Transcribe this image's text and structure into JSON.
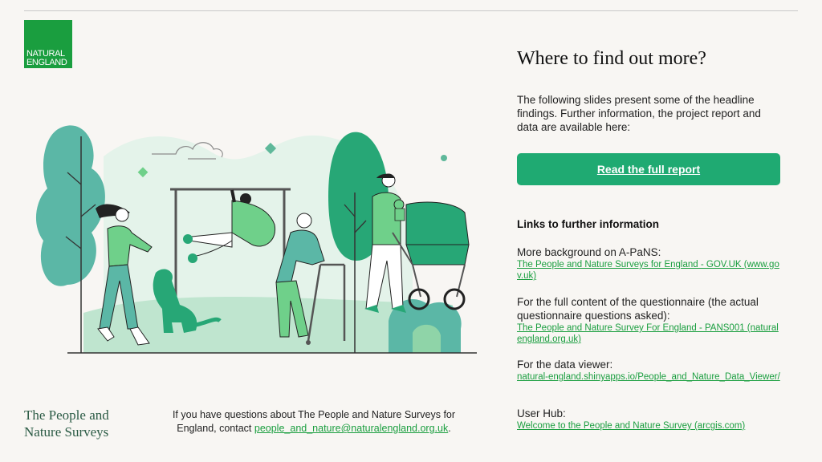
{
  "logo": {
    "line1": "NATURAL",
    "line2": "ENGLAND"
  },
  "brand": {
    "line1": "The People and",
    "line2": "Nature Surveys"
  },
  "contact": {
    "text": "If you have questions about The People and Nature Surveys for England, contact",
    "email": "people_and_nature@naturalengland.org.uk",
    "suffix": "."
  },
  "main": {
    "title": "Where to find out more?",
    "intro": "The following slides present some of the headline findings. Further information, the project report and data are available here:",
    "cta_label": "Read the full report",
    "links_heading": "Links to further information",
    "links": [
      {
        "label": "More background on A-PaNS:",
        "link": "The People and Nature Surveys for England - GOV.UK (www.gov.uk)"
      },
      {
        "label": "For the full content of the questionnaire (the actual questionnaire questions asked):",
        "link": "The People and Nature Survey For England - PANS001 (naturalengland.org.uk)"
      },
      {
        "label": "For the data viewer:",
        "link": "natural-england.shinyapps.io/People_and_Nature_Data_Viewer/"
      },
      {
        "label": "User Hub:",
        "link": "Welcome to the People and Nature Survey (arcgis.com)"
      }
    ]
  },
  "colors": {
    "brand_green": "#1a9e3f",
    "button_green": "#1faa72",
    "background": "#f8f6f3"
  },
  "illustration": "people-in-park-illustration"
}
